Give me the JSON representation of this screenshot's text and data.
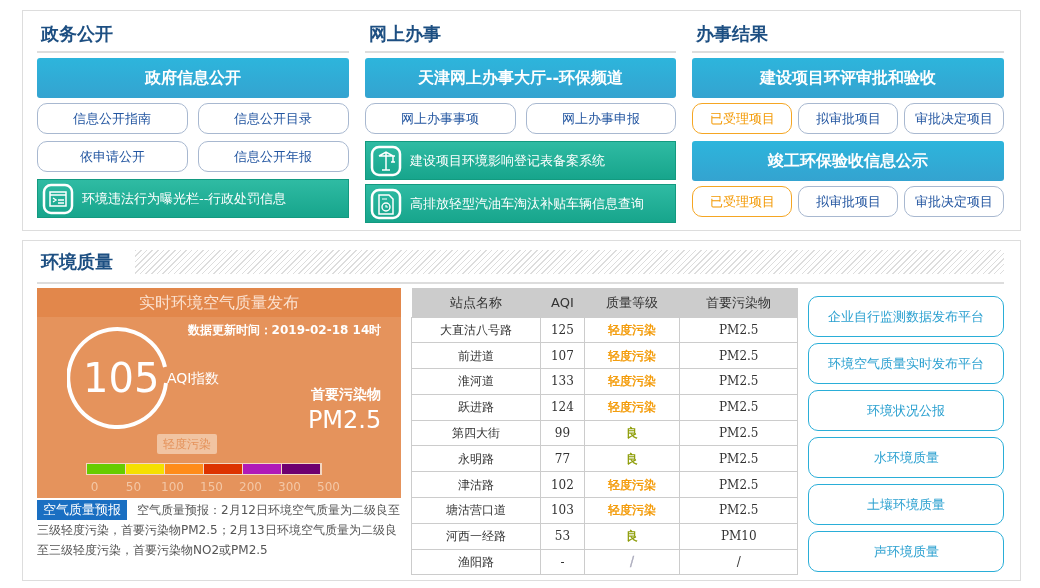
{
  "services": [
    {
      "title": "政务公开",
      "blocks": [
        {
          "kind": "header",
          "text": "政府信息公开"
        },
        {
          "kind": "pills",
          "items": [
            {
              "text": "信息公开指南",
              "selected": false
            },
            {
              "text": "信息公开目录",
              "selected": false
            }
          ]
        },
        {
          "kind": "pills",
          "items": [
            {
              "text": "依申请公开",
              "selected": false
            },
            {
              "text": "信息公开年报",
              "selected": false
            }
          ]
        },
        {
          "kind": "feature",
          "text": "环境违法行为曝光栏--行政处罚信息"
        }
      ]
    },
    {
      "title": "网上办事",
      "blocks": [
        {
          "kind": "header",
          "text": "天津网上办事大厅--环保频道"
        },
        {
          "kind": "pills",
          "items": [
            {
              "text": "网上办事事项",
              "selected": false
            },
            {
              "text": "网上办事申报",
              "selected": false
            }
          ]
        },
        {
          "kind": "feature",
          "text": "建设项目环境影响登记表备案系统"
        },
        {
          "kind": "feature",
          "text": "高排放轻型汽油车淘汰补贴车辆信息查询"
        }
      ]
    },
    {
      "title": "办事结果",
      "blocks": [
        {
          "kind": "header",
          "text": "建设项目环评审批和验收"
        },
        {
          "kind": "pills",
          "items": [
            {
              "text": "已受理项目",
              "selected": true
            },
            {
              "text": "拟审批项目",
              "selected": false
            },
            {
              "text": "审批决定项目",
              "selected": false
            }
          ]
        },
        {
          "kind": "header",
          "text": "竣工环保验收信息公示"
        },
        {
          "kind": "pills",
          "items": [
            {
              "text": "已受理项目",
              "selected": true
            },
            {
              "text": "拟审批项目",
              "selected": false
            },
            {
              "text": "审批决定项目",
              "selected": false
            }
          ]
        }
      ]
    }
  ],
  "environment": {
    "title": "环境质量",
    "air": {
      "title": "实时环境空气质量发布",
      "update_time": "数据更新时间：2019-02-18 14时",
      "aqi": "105",
      "aqi_label": "AQI指数",
      "primary_label": "首要污染物",
      "primary_value": "PM2.5",
      "level_tag": {
        "text": "轻度污染",
        "level": 0.42
      },
      "scale": [
        {
          "color": "#66cc00"
        },
        {
          "color": "#f5e000"
        },
        {
          "color": "#ff8c1a"
        },
        {
          "color": "#dd3300"
        },
        {
          "color": "#b01ab8"
        },
        {
          "color": "#6e0070"
        }
      ],
      "ticks": [
        "0",
        "50",
        "100",
        "150",
        "200",
        "300",
        "500"
      ]
    },
    "forecast": {
      "label": "空气质量预报",
      "text": "空气质量预报：2月12日环境空气质量为二级良至三级轻度污染，首要污染物PM2.5；2月13日环境空气质量为二级良至三级轻度污染，首要污染物NO2或PM2.5"
    },
    "table": {
      "columns": [
        "站点名称",
        "AQI",
        "质量等级",
        "首要污染物"
      ],
      "rows": [
        {
          "station": "大直沽八号路",
          "aqi": "125",
          "grade": "轻度污染",
          "color": "#f39800",
          "pollutant": "PM2.5"
        },
        {
          "station": "前进道",
          "aqi": "107",
          "grade": "轻度污染",
          "color": "#f39800",
          "pollutant": "PM2.5"
        },
        {
          "station": "淮河道",
          "aqi": "133",
          "grade": "轻度污染",
          "color": "#f39800",
          "pollutant": "PM2.5"
        },
        {
          "station": "跃进路",
          "aqi": "124",
          "grade": "轻度污染",
          "color": "#f39800",
          "pollutant": "PM2.5"
        },
        {
          "station": "第四大街",
          "aqi": "99",
          "grade": "良",
          "color": "#8a9a00",
          "pollutant": "PM2.5"
        },
        {
          "station": "永明路",
          "aqi": "77",
          "grade": "良",
          "color": "#8a9a00",
          "pollutant": "PM2.5"
        },
        {
          "station": "津沽路",
          "aqi": "102",
          "grade": "轻度污染",
          "color": "#f39800",
          "pollutant": "PM2.5"
        },
        {
          "station": "塘沽营口道",
          "aqi": "103",
          "grade": "轻度污染",
          "color": "#f39800",
          "pollutant": "PM2.5"
        },
        {
          "station": "河西一经路",
          "aqi": "53",
          "grade": "良",
          "color": "#8a9a00",
          "pollutant": "PM10"
        },
        {
          "station": "渔阳路",
          "aqi": "-",
          "grade": "/",
          "color": "#aaaabb",
          "pollutant": "/"
        }
      ]
    },
    "links": [
      "企业自行监测数据发布平台",
      "环境空气质量实时发布平台",
      "环境状况公报",
      "水环境质量",
      "土壤环境质量",
      "声环境质量"
    ]
  }
}
